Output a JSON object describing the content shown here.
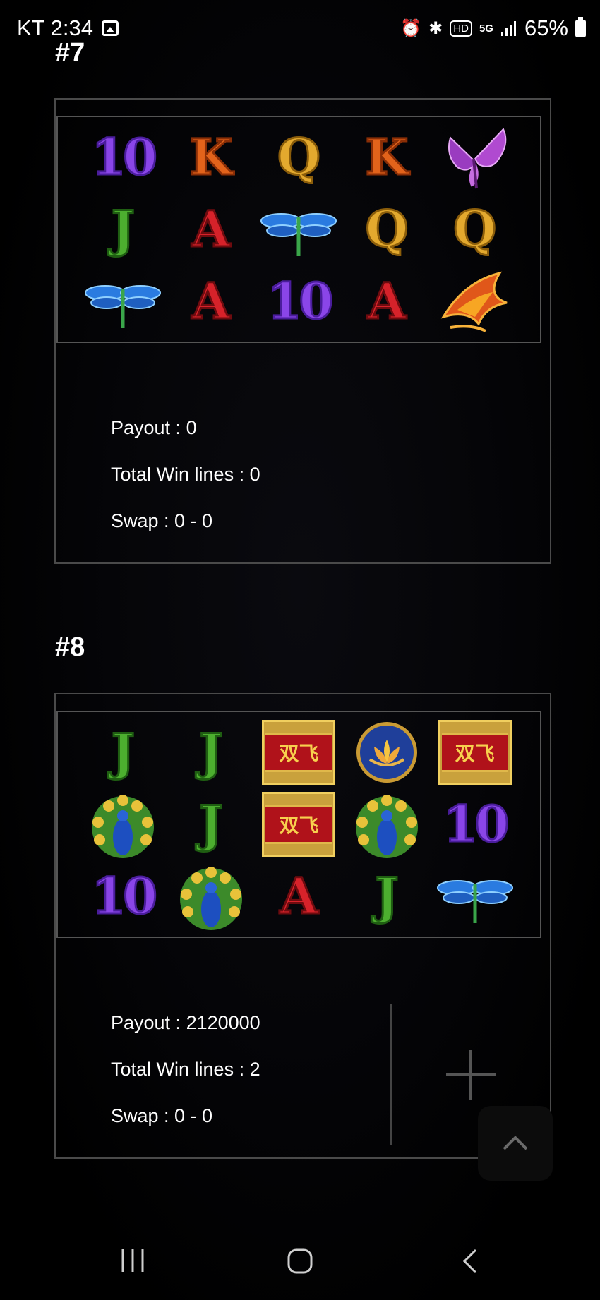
{
  "status_bar": {
    "carrier_time": "KT 2:34",
    "status_glyphs": [
      "⏰",
      "✱",
      "HD",
      "5G",
      "📶"
    ],
    "battery": "65%"
  },
  "spins": [
    {
      "label": "#7",
      "grid": [
        [
          "10",
          "K",
          "Q",
          "K",
          "butterfly"
        ],
        [
          "J",
          "A",
          "dragonfly",
          "Q",
          "Q"
        ],
        [
          "dragonfly",
          "A",
          "10",
          "A",
          "phoenix"
        ]
      ],
      "payout": "Payout : 0",
      "win_lines": "Total Win lines : 0",
      "swap": "Swap : 0 - 0"
    },
    {
      "label": "#8",
      "grid": [
        [
          "J",
          "J",
          "gold-tile",
          "lotus",
          "gold-tile"
        ],
        [
          "peacock",
          "J",
          "gold-tile",
          "peacock",
          "10"
        ],
        [
          "10",
          "peacock",
          "A",
          "J",
          "dragonfly"
        ]
      ],
      "gold_tile_text": "双飞",
      "payout": "Payout : 2120000",
      "win_lines": "Total Win lines : 2",
      "swap": "Swap : 0 - 0"
    }
  ],
  "colors": {
    "background": "#000000",
    "card_border": "#4a4a4a",
    "ten": "#8a45e8",
    "K": "#e2631b",
    "Q": "#e3a92e",
    "J": "#4cae2f",
    "A": "#d6222a"
  },
  "icons": {
    "expand": "plus-icon",
    "scroll_top": "chevron-up-icon",
    "nav_recents": "recents-icon",
    "nav_home": "home-icon",
    "nav_back": "back-icon"
  }
}
